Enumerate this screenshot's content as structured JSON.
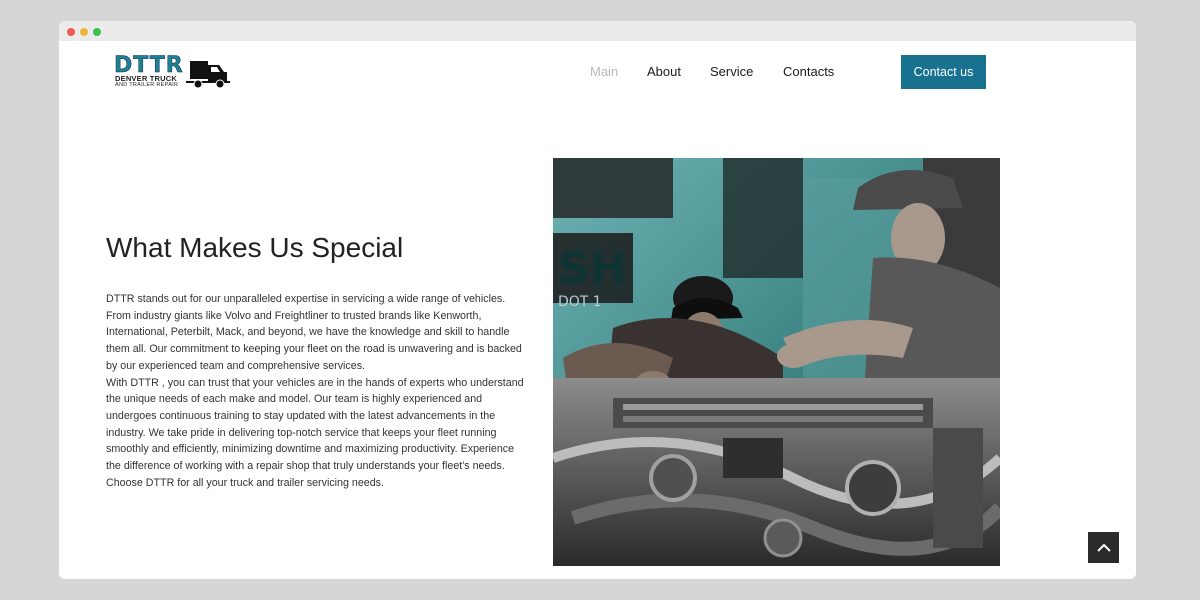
{
  "logo": {
    "main": "DTTR",
    "line1": "DENVER TRUCK",
    "line2": "AND TRAILER REPAIR"
  },
  "nav": {
    "items": [
      {
        "label": "Main",
        "active": true
      },
      {
        "label": "About",
        "active": false
      },
      {
        "label": "Service",
        "active": false
      },
      {
        "label": "Contacts",
        "active": false
      }
    ]
  },
  "header": {
    "contact_label": "Contact us"
  },
  "colors": {
    "accent": "#17718f",
    "nav_active": "#b7b7b7",
    "scroll_button": "#2b2b2b"
  },
  "section": {
    "title": "What Makes Us Special",
    "paragraph1": "DTTR stands out for our unparalleled expertise in servicing a wide range of vehicles. From industry giants like Volvo and Freightliner to trusted brands like Kenworth, International, Peterbilt, Mack, and beyond, we have the knowledge and skill to handle them all. Our commitment to keeping your fleet on the road is unwavering and is backed by our experienced team and comprehensive services.",
    "paragraph2": "With DTTR , you can trust that your vehicles are in the hands of experts who understand the unique needs of each make and model. Our team is highly experienced and undergoes continuous training to stay updated with the latest advancements in the industry. We take pride in delivering top-notch service that keeps your fleet running smoothly and efficiently, minimizing downtime and maximizing productivity. Experience the difference of working with a repair shop that truly understands your fleet's needs. Choose DTTR for all your truck and trailer servicing needs.",
    "photo_sign": "SH",
    "photo_dot": "DOT 1"
  },
  "icons": {
    "scroll_top": "chevron-up-icon",
    "truck": "truck-icon"
  }
}
